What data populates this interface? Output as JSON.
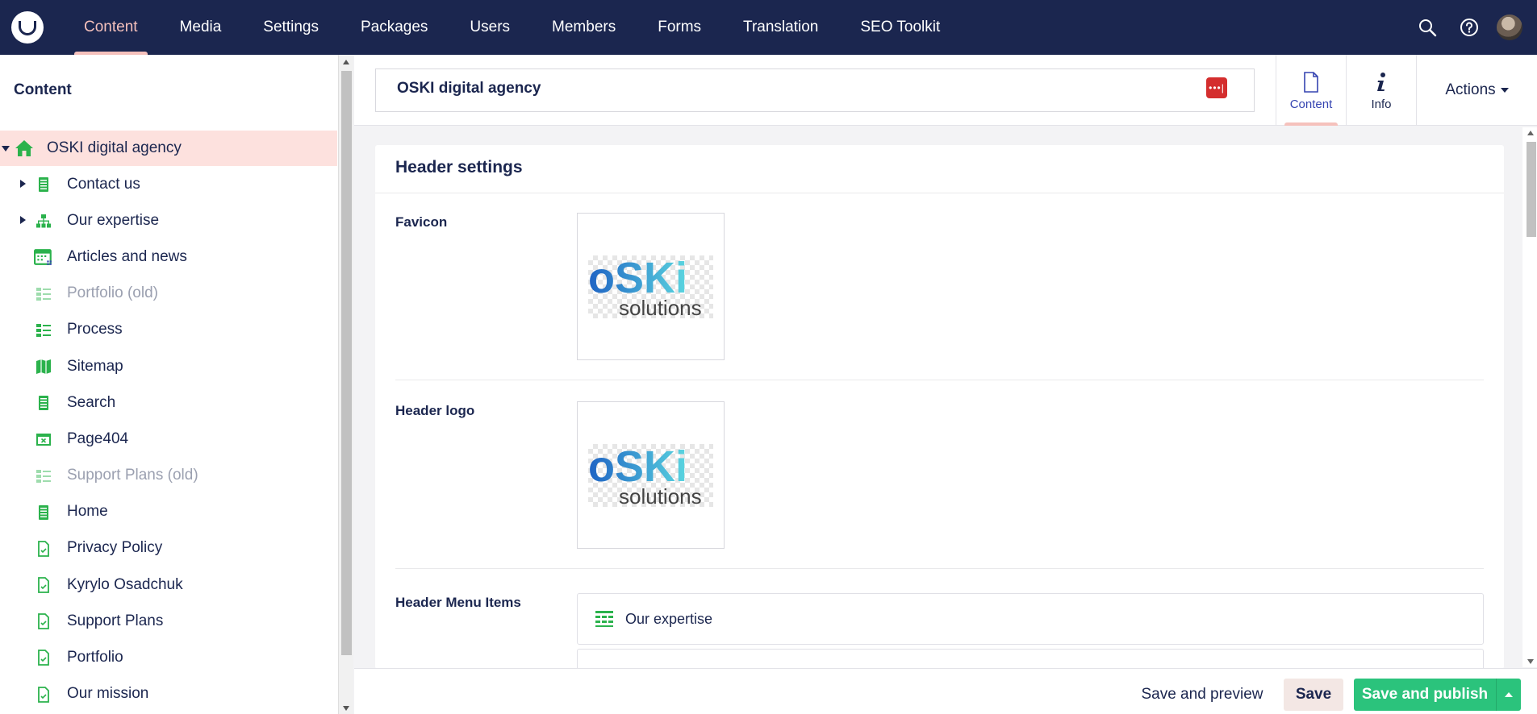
{
  "topbar": {
    "nav": [
      {
        "label": "Content",
        "active": true
      },
      {
        "label": "Media"
      },
      {
        "label": "Settings"
      },
      {
        "label": "Packages"
      },
      {
        "label": "Users"
      },
      {
        "label": "Members"
      },
      {
        "label": "Forms"
      },
      {
        "label": "Translation"
      },
      {
        "label": "SEO Toolkit"
      }
    ],
    "icons": [
      "search-icon",
      "help-icon",
      "user-avatar"
    ]
  },
  "sidebar": {
    "title": "Content",
    "tree": [
      {
        "label": "OSKI digital agency",
        "icon": "home-icon",
        "expanded": true,
        "selected": true
      },
      {
        "label": "Contact us",
        "icon": "document-icon",
        "has_children": true
      },
      {
        "label": "Our expertise",
        "icon": "sitemap-icon",
        "has_children": true
      },
      {
        "label": "Articles and news",
        "icon": "calendar-icon"
      },
      {
        "label": "Portfolio (old)",
        "icon": "list-icon",
        "muted": true
      },
      {
        "label": "Process",
        "icon": "list-icon"
      },
      {
        "label": "Sitemap",
        "icon": "map-icon"
      },
      {
        "label": "Search",
        "icon": "document-icon"
      },
      {
        "label": "Page404",
        "icon": "browser-window-icon"
      },
      {
        "label": "Support Plans (old)",
        "icon": "list-icon",
        "muted": true
      },
      {
        "label": "Home",
        "icon": "document-icon"
      },
      {
        "label": "Privacy Policy",
        "icon": "file-icon"
      },
      {
        "label": "Kyrylo Osadchuk",
        "icon": "file-icon"
      },
      {
        "label": "Support Plans",
        "icon": "file-icon"
      },
      {
        "label": "Portfolio",
        "icon": "file-icon"
      },
      {
        "label": "Our mission",
        "icon": "file-icon"
      }
    ]
  },
  "editor": {
    "node_name": "OSKI digital agency",
    "apps": [
      {
        "label": "Content",
        "icon": "document-icon",
        "active": true
      },
      {
        "label": "Info",
        "icon": "info-icon"
      }
    ],
    "actions_label": "Actions"
  },
  "panel": {
    "title": "Header settings",
    "properties": {
      "favicon": {
        "label": "Favicon",
        "image_text_top": "oSKi",
        "image_text_bottom": "solutions"
      },
      "header_logo": {
        "label": "Header logo",
        "image_text_top": "oSKi",
        "image_text_bottom": "solutions"
      },
      "header_menu": {
        "label": "Header Menu Items",
        "items": [
          "Our expertise"
        ]
      }
    }
  },
  "footer": {
    "preview": "Save and preview",
    "save": "Save",
    "publish": "Save and publish"
  },
  "colors": {
    "topbar": "#1b264f",
    "accent_pink": "#f5c1bc",
    "selected_row": "#fde1de",
    "green_icon": "#2bb24c",
    "publish_button": "#2bc37c"
  }
}
